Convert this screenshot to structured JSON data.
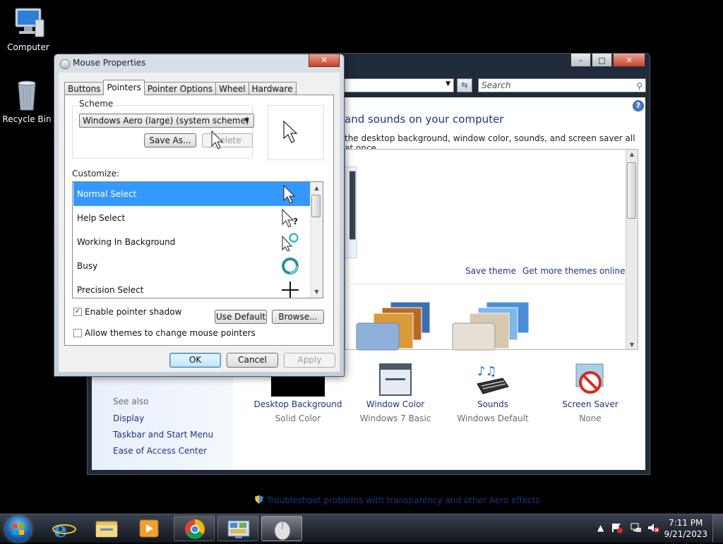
{
  "desktop": {
    "icons": [
      {
        "label": "Computer",
        "icon": "computer-icon"
      },
      {
        "label": "Recycle Bin",
        "icon": "recycle-bin-icon"
      }
    ]
  },
  "personalization": {
    "search_placeholder": "Search",
    "heading": "and sounds on your computer",
    "subtext": "the desktop background, window color, sounds, and screen saver all at once.",
    "save_theme": "Save theme",
    "more_themes": "Get more themes online",
    "see_also": "See also",
    "links": [
      "Display",
      "Taskbar and Start Menu",
      "Ease of Access Center"
    ],
    "bottom": [
      {
        "label": "Desktop Background",
        "value": "Solid Color",
        "icon": "desktop-background-icon"
      },
      {
        "label": "Window Color",
        "value": "Windows 7 Basic",
        "icon": "window-color-icon"
      },
      {
        "label": "Sounds",
        "value": "Windows Default",
        "icon": "sounds-icon"
      },
      {
        "label": "Screen Saver",
        "value": "None",
        "icon": "screen-saver-icon"
      }
    ],
    "troubleshoot": "Troubleshoot problems with transparency and other Aero effects"
  },
  "mouse_dialog": {
    "title": "Mouse Properties",
    "close": "✕",
    "tabs": [
      "Buttons",
      "Pointers",
      "Pointer Options",
      "Wheel",
      "Hardware"
    ],
    "active_tab": "Pointers",
    "scheme_label": "Scheme",
    "scheme_value": "Windows Aero (large) (system scheme)",
    "save_as": "Save As...",
    "delete": "Delete",
    "customize_label": "Customize:",
    "cursors": [
      {
        "name": "Normal Select",
        "icon": "arrow-pointer-icon",
        "selected": true
      },
      {
        "name": "Help Select",
        "icon": "help-pointer-icon",
        "selected": false
      },
      {
        "name": "Working In Background",
        "icon": "working-pointer-icon",
        "selected": false
      },
      {
        "name": "Busy",
        "icon": "busy-pointer-icon",
        "selected": false
      },
      {
        "name": "Precision Select",
        "icon": "precision-pointer-icon",
        "selected": false
      }
    ],
    "enable_shadow": {
      "label": "Enable pointer shadow",
      "checked": true
    },
    "allow_themes": {
      "label": "Allow themes to change mouse pointers",
      "checked": false
    },
    "use_default": "Use Default",
    "browse": "Browse...",
    "ok": "OK",
    "cancel": "Cancel",
    "apply": "Apply"
  },
  "taskbar": {
    "time": "7:11 PM",
    "date": "9/21/2023",
    "tray_arrow": "▲"
  },
  "colors": {
    "selection": "#3399ff",
    "link": "#1e3287"
  }
}
